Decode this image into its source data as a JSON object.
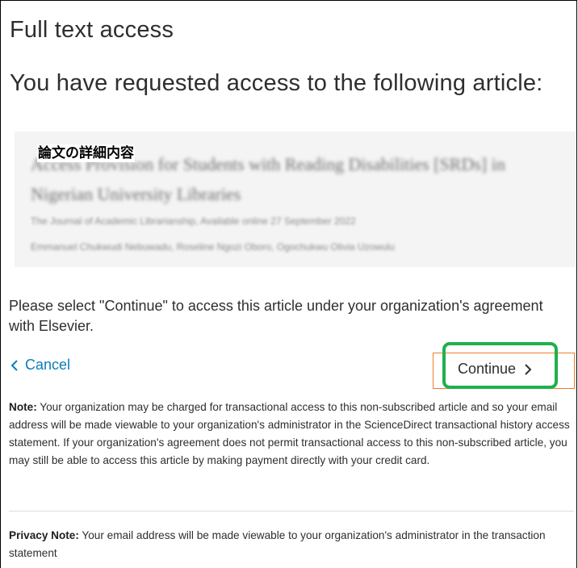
{
  "header": {
    "title": "Full text access",
    "subtitle": "You have requested access to the following article:"
  },
  "article": {
    "overlay_label": "論文の詳細内容",
    "title": "Access Provision for Students with Reading Disabilities [SRDs] in Nigerian University Libraries",
    "journal": "The Journal of Academic Librarianship, Available online 27 September 2022",
    "authors": "Emmanuel Chukwudi Nebuwadu, Roseline Ngozi Oboro, Ogochukwu Olivia Uzowulu"
  },
  "instruction": "Please select \"Continue\" to access this article under your organization's agreement with Elsevier.",
  "actions": {
    "cancel_label": "Cancel",
    "continue_label": "Continue"
  },
  "note": {
    "label": "Note:",
    "text": " Your organization may be charged for transactional access to this non-subscribed article and so your email address will be made viewable to your organization's administrator in the ScienceDirect transactional history access statement. If your organization's agreement does not permit transactional access to this non-subscribed article, you may still be able to access this article by making payment directly with your credit card."
  },
  "privacy": {
    "label": "Privacy Note:",
    "text": " Your email address will be made viewable to your organization's administrator in the transaction statement"
  },
  "icons": {
    "cancel": "chevron-left-icon",
    "continue": "chevron-right-icon"
  },
  "colors": {
    "link": "#0c7dbb",
    "text": "#2e2e2e",
    "card_background": "#f4f4f4",
    "highlight_green": "#1fb14c",
    "highlight_orange": "#f07d28"
  }
}
